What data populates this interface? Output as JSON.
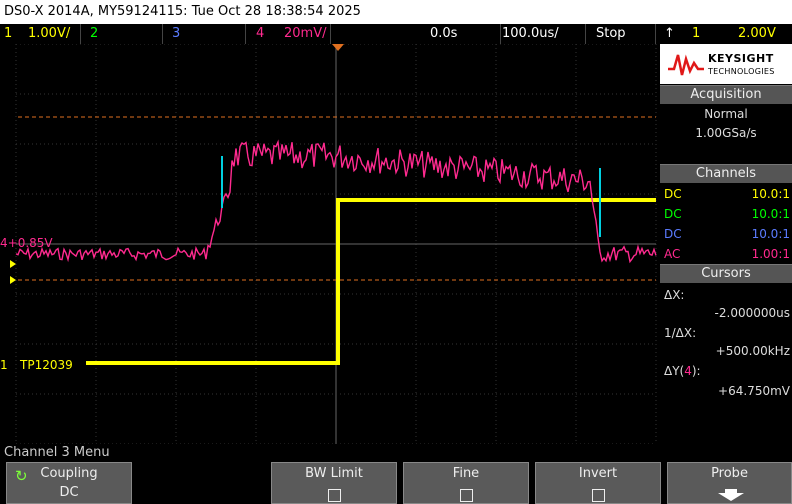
{
  "title": "DS0-X 2014A, MY59124115: Tue Oct 28 18:38:54 2025",
  "status": {
    "ch1_num": "1",
    "ch1_scale": "1.00V/",
    "ch2_num": "2",
    "ch3_num": "3",
    "ch4_num": "4",
    "ch4_scale": "20mV/",
    "time_offset": "0.0s",
    "timebase": "100.0us/",
    "run_state": "Stop",
    "trig_src": "1",
    "trig_level": "2.00V"
  },
  "brand": {
    "name": "KEYSIGHT",
    "sub": "TECHNOLOGIES"
  },
  "acquisition": {
    "header": "Acquisition",
    "mode": "Normal",
    "rate": "1.00GSa/s"
  },
  "channels": {
    "header": "Channels",
    "rows": [
      {
        "coupling": "DC",
        "probe": "10.0:1",
        "color": "#ffff00"
      },
      {
        "coupling": "DC",
        "probe": "10.0:1",
        "color": "#00ff00"
      },
      {
        "coupling": "DC",
        "probe": "10.0:1",
        "color": "#5b7cff"
      },
      {
        "coupling": "AC",
        "probe": "1.00:1",
        "color": "#ff2a8f"
      }
    ]
  },
  "cursors": {
    "header": "Cursors",
    "dx_label": "ΔX:",
    "dx_value": "-2.000000us",
    "inv_label": "1/ΔX:",
    "inv_value": "+500.00kHz",
    "dy_label_pre": "ΔY(",
    "dy_ch": "4",
    "dy_label_post": "):",
    "dy_value": "+64.750mV"
  },
  "markers": {
    "ch4_level": "4+0.85V",
    "ch1_label": "1",
    "tp_label": "TP12039"
  },
  "menu": {
    "title": "Channel 3 Menu",
    "keys": [
      {
        "top": "Coupling",
        "bottom": "DC"
      },
      {
        "top": "BW Limit"
      },
      {
        "top": "Fine"
      },
      {
        "top": "Invert"
      },
      {
        "top": "Probe"
      }
    ]
  },
  "colors": {
    "ch1": "#ffff00",
    "ch2": "#00ff00",
    "ch3": "#5b7cff",
    "ch4": "#ff2a8f",
    "cursor": "#e07020",
    "cursor_y": "#00d0e0"
  }
}
